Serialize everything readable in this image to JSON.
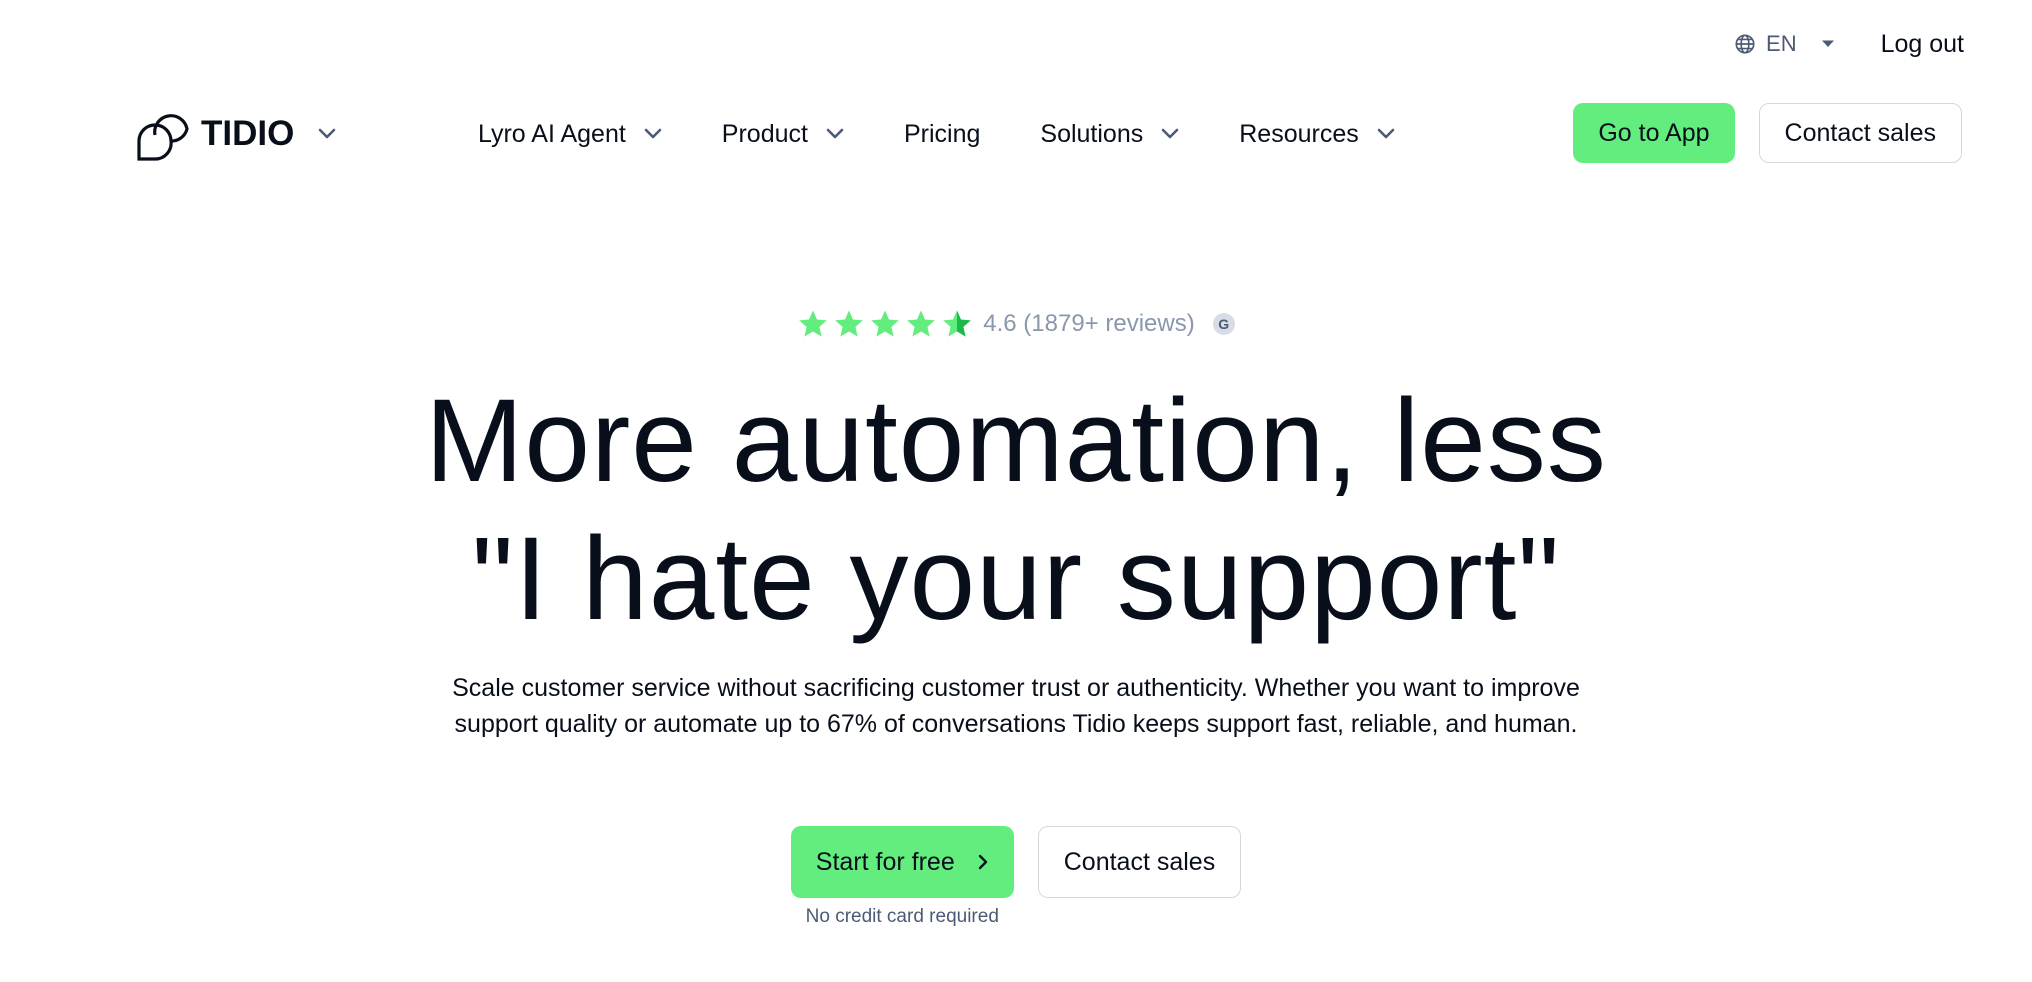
{
  "topbar": {
    "language": "EN",
    "logout_label": "Log out"
  },
  "brand": {
    "name": "TIDIO"
  },
  "nav": {
    "items": [
      {
        "label": "Lyro AI Agent",
        "has_dropdown": true
      },
      {
        "label": "Product",
        "has_dropdown": true
      },
      {
        "label": "Pricing",
        "has_dropdown": false
      },
      {
        "label": "Solutions",
        "has_dropdown": true
      },
      {
        "label": "Resources",
        "has_dropdown": true
      }
    ],
    "go_to_app_label": "Go to App",
    "contact_sales_label": "Contact sales"
  },
  "hero": {
    "rating": {
      "stars_filled": 4.6,
      "stars_total": 5,
      "text": "4.6 (1879+ reviews)",
      "badge": "G"
    },
    "headline_line1": "More automation, less",
    "headline_line2": "\"I hate your support\"",
    "subtext_line1": "Scale customer service without sacrificing customer trust or authenticity. Whether you want to improve",
    "subtext_line2": "support quality or automate up to 67% of conversations Tidio keeps support fast, reliable, and human.",
    "start_label": "Start for free",
    "contact_label": "Contact sales",
    "no_cc_note": "No credit card required"
  },
  "colors": {
    "accent_green": "#62ed7e",
    "star_green": "#45d068",
    "text_dark": "#080f1a",
    "muted": "#8a97ad",
    "border": "#d3d8df"
  }
}
